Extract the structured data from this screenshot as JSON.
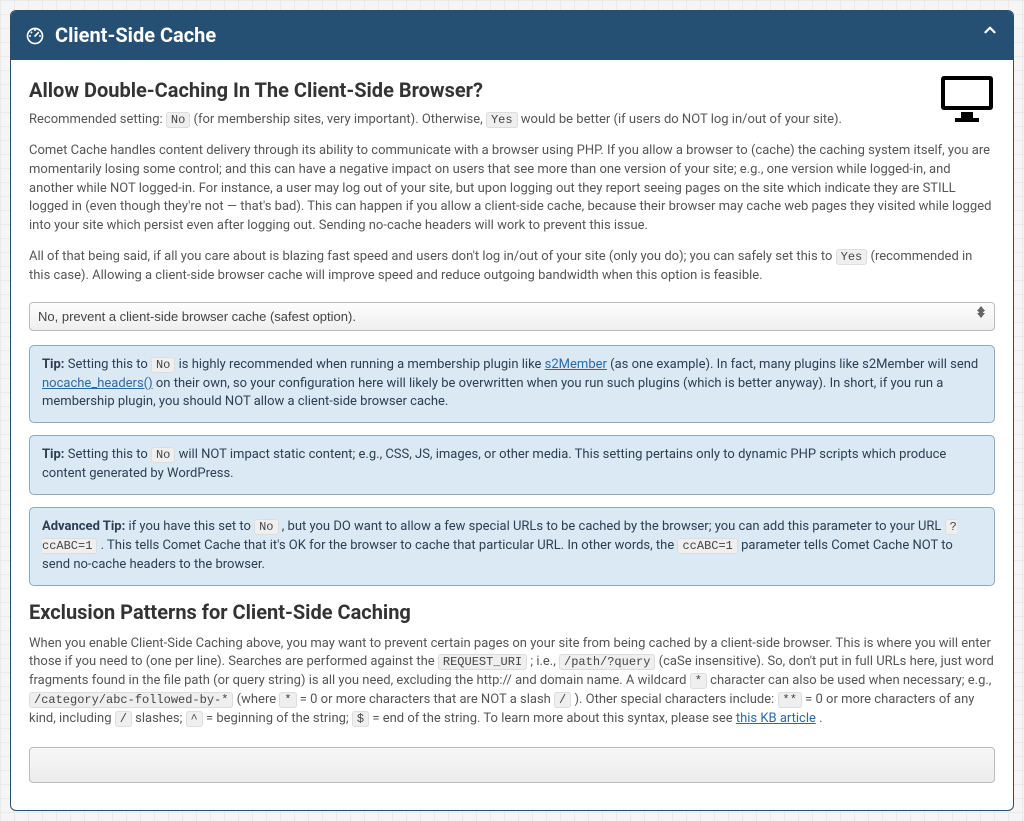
{
  "panel": {
    "title": "Client-Side Cache"
  },
  "section1": {
    "heading": "Allow Double-Caching In The Client-Side Browser?",
    "rec_prefix": "Recommended setting: ",
    "rec_no": "No",
    "rec_mid": " (for membership sites, very important). Otherwise, ",
    "rec_yes": "Yes",
    "rec_suffix": " would be better (if users do NOT log in/out of your site).",
    "para1": "Comet Cache handles content delivery through its ability to communicate with a browser using PHP. If you allow a browser to (cache) the caching system itself, you are momentarily losing some control; and this can have a negative impact on users that see more than one version of your site; e.g., one version while logged-in, and another while NOT logged-in. For instance, a user may log out of your site, but upon logging out they report seeing pages on the site which indicate they are STILL logged in (even though they're not — that's bad). This can happen if you allow a client-side cache, because their browser may cache web pages they visited while logged into your site which persist even after logging out. Sending no-cache headers will work to prevent this issue.",
    "para2_a": "All of that being said, if all you care about is blazing fast speed and users don't log in/out of your site (only you do); you can safely set this to ",
    "para2_yes": "Yes",
    "para2_b": " (recommended in this case). Allowing a client-side browser cache will improve speed and reduce outgoing bandwidth when this option is feasible.",
    "select_value": "No, prevent a client-side browser cache (safest option)."
  },
  "tip1": {
    "label": "Tip:",
    "a": " Setting this to ",
    "no": "No",
    "b": " is highly recommended when running a membership plugin like ",
    "link1": "s2Member",
    "c": " (as one example). In fact, many plugins like s2Member will send ",
    "link2": "nocache_headers()",
    "d": " on their own, so your configuration here will likely be overwritten when you run such plugins (which is better anyway). In short, if you run a membership plugin, you should NOT allow a client-side browser cache."
  },
  "tip2": {
    "label": "Tip:",
    "a": " Setting this to ",
    "no": "No",
    "b": " will NOT impact static content; e.g., CSS, JS, images, or other media. This setting pertains only to dynamic PHP scripts which produce content generated by WordPress."
  },
  "tip3": {
    "label": "Advanced Tip:",
    "a": " if you have this set to ",
    "no": "No",
    "b": " , but you DO want to allow a few special URLs to be cached by the browser; you can add this parameter to your URL ",
    "param1": "?ccABC=1",
    "c": " . This tells Comet Cache that it's OK for the browser to cache that particular URL. In other words, the ",
    "param2": "ccABC=1",
    "d": " parameter tells Comet Cache NOT to send no-cache headers to the browser."
  },
  "section2": {
    "heading": "Exclusion Patterns for Client-Side Caching",
    "a": "When you enable Client-Side Caching above, you may want to prevent certain pages on your site from being cached by a client-side browser. This is where you will enter those if you need to (one per line). Searches are performed against the ",
    "code1": "REQUEST_URI",
    "b": " ; i.e., ",
    "code2": "/path/?query",
    "c": " (caSe insensitive). So, don't put in full URLs here, just word fragments found in the file path (or query string) is all you need, excluding the http:// and domain name. A wildcard ",
    "code3": "*",
    "d": " character can also be used when necessary; e.g., ",
    "code4": "/category/abc-followed-by-*",
    "e": " (where ",
    "code5": "*",
    "f": " = 0 or more characters that are NOT a slash ",
    "code6": "/",
    "g": " ). Other special characters include: ",
    "code7": "**",
    "h": " = 0 or more characters of any kind, including ",
    "code8": "/",
    "i": " slashes; ",
    "code9": "^",
    "j": " = beginning of the string; ",
    "code10": "$",
    "k": " = end of the string. To learn more about this syntax, please see ",
    "link": "this KB article",
    "l": "."
  }
}
